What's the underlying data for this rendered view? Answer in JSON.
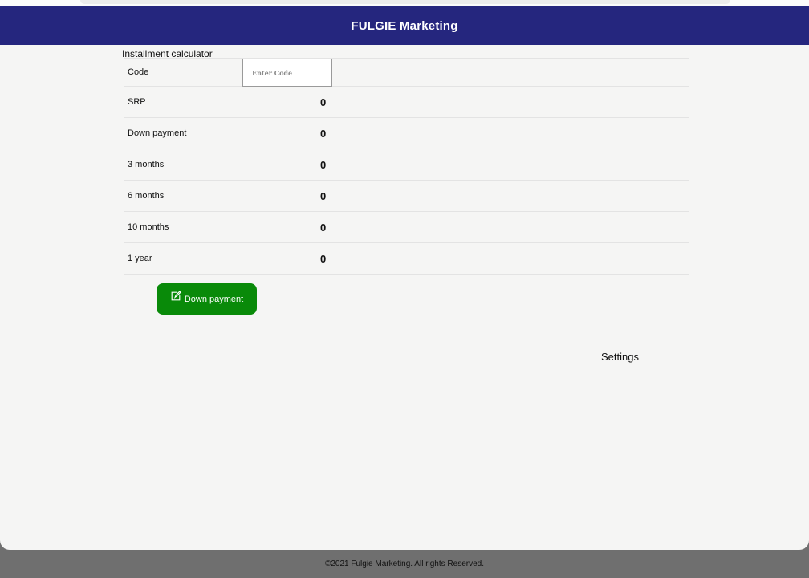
{
  "header": {
    "title": "FULGIE Marketing"
  },
  "calculator": {
    "title": "Installment calculator",
    "code": {
      "label": "Code",
      "placeholder": "Enter Code",
      "value": ""
    },
    "rows": [
      {
        "label": "SRP",
        "value": "0"
      },
      {
        "label": "Down payment",
        "value": "0"
      },
      {
        "label": "3 months",
        "value": "0"
      },
      {
        "label": "6 months",
        "value": "0"
      },
      {
        "label": "10 months",
        "value": "0"
      },
      {
        "label": "1 year",
        "value": "0"
      }
    ],
    "down_payment_button": {
      "label": "Down payment",
      "icon": "edit-icon"
    }
  },
  "settings": {
    "label": "Settings"
  },
  "footer": {
    "text": "©2021 Fulgie Marketing. All rights Reserved."
  },
  "colors": {
    "header_bg": "#25267e",
    "button_bg": "#098a09",
    "page_bg": "#f5f5f4",
    "footer_bg": "#6f6f6f"
  }
}
